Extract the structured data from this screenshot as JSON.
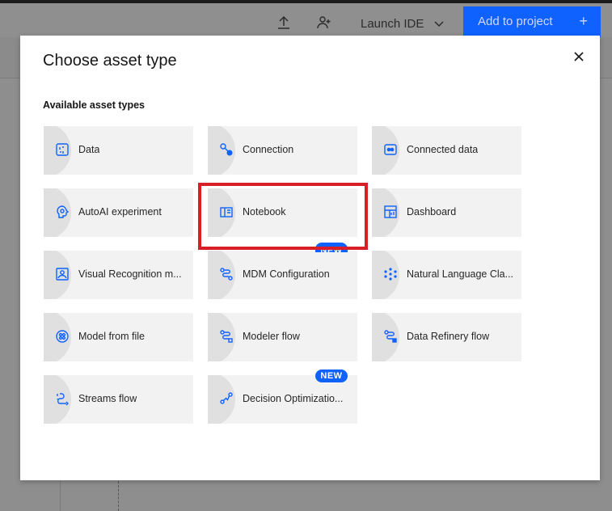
{
  "topbar": {
    "launch_ide_label": "Launch IDE",
    "add_to_project_label": "Add to project",
    "add_plus": "+"
  },
  "modal": {
    "title": "Choose asset type",
    "section_label": "Available asset types",
    "tiles": [
      {
        "label": "Data",
        "icon": "data-icon"
      },
      {
        "label": "Connection",
        "icon": "connection-icon"
      },
      {
        "label": "Connected data",
        "icon": "connected-data-icon"
      },
      {
        "label": "AutoAI experiment",
        "icon": "autoai-icon"
      },
      {
        "label": "Notebook",
        "icon": "notebook-icon"
      },
      {
        "label": "Dashboard",
        "icon": "dashboard-icon"
      },
      {
        "label": "Visual Recognition m...",
        "icon": "visual-recognition-icon"
      },
      {
        "label": "MDM Configuration",
        "icon": "mdm-icon",
        "badge": "NEW"
      },
      {
        "label": "Natural Language Cla...",
        "icon": "nlc-icon"
      },
      {
        "label": "Model from file",
        "icon": "model-file-icon"
      },
      {
        "label": "Modeler flow",
        "icon": "modeler-flow-icon"
      },
      {
        "label": "Data Refinery flow",
        "icon": "refinery-icon"
      },
      {
        "label": "Streams flow",
        "icon": "streams-flow-icon"
      },
      {
        "label": "Decision Optimizatio...",
        "icon": "decision-optimization-icon",
        "badge": "NEW"
      }
    ]
  },
  "colors": {
    "accent": "#0f62fe",
    "highlight": "#da1e28"
  }
}
